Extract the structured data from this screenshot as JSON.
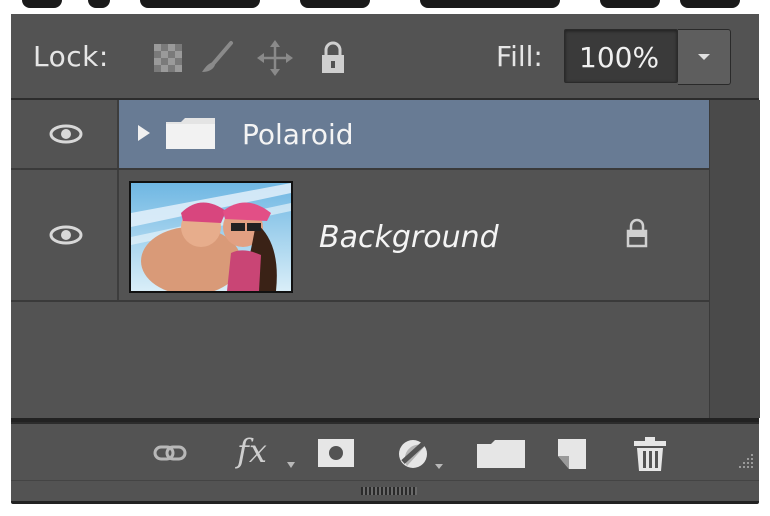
{
  "lockbar": {
    "lock_label": "Lock:",
    "lock_icons": [
      "lock-transparent-pixels-icon",
      "lock-image-pixels-icon",
      "lock-position-icon",
      "lock-all-icon"
    ],
    "fill_label": "Fill:",
    "fill_value": "100%"
  },
  "layers": [
    {
      "name": "Polaroid",
      "type": "group",
      "visible": true,
      "selected": true,
      "collapsed": true
    },
    {
      "name": "Background",
      "type": "image",
      "visible": true,
      "locked": true
    }
  ],
  "bottom_bar": {
    "fx_label": "fx",
    "icons": [
      "link-layers-icon",
      "add-layer-style-icon",
      "add-mask-icon",
      "new-adjustment-layer-icon",
      "new-group-icon",
      "new-layer-icon",
      "delete-layer-icon"
    ]
  },
  "colors": {
    "panel_bg": "#535353",
    "selected_row": "#687b94",
    "text": "#f4f4f4"
  }
}
